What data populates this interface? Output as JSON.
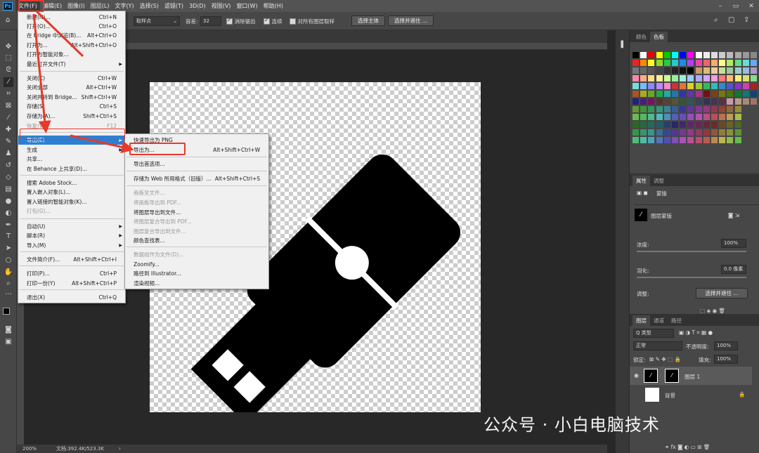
{
  "app": {
    "logo": "Ps"
  },
  "menubar": [
    "文件(F)",
    "编辑(E)",
    "图像(I)",
    "图层(L)",
    "文字(Y)",
    "选择(S)",
    "滤镜(T)",
    "3D(D)",
    "视图(V)",
    "窗口(W)",
    "帮助(H)"
  ],
  "options": {
    "sample_value": "取样点",
    "tolerance_label": "容差:",
    "tolerance_value": "32",
    "antialias": "消除锯齿",
    "contiguous": "连续",
    "sample_all": "对所有图层取样",
    "select_subject": "选择主体",
    "select_mask": "选择并遮住 ..."
  },
  "file_menu": [
    {
      "label": "新建(N)...",
      "shortcut": "Ctrl+N"
    },
    {
      "label": "打开(O)...",
      "shortcut": "Ctrl+O"
    },
    {
      "label": "在 Bridge 中浏览(B)...",
      "shortcut": "Alt+Ctrl+O"
    },
    {
      "label": "打开为...",
      "shortcut": "Alt+Shift+Ctrl+O"
    },
    {
      "label": "打开为智能对象...",
      "shortcut": ""
    },
    {
      "label": "最近打开文件(T)",
      "shortcut": "",
      "sub": true
    },
    {
      "label": "关闭(C)",
      "shortcut": "Ctrl+W"
    },
    {
      "label": "关闭全部",
      "shortcut": "Alt+Ctrl+W"
    },
    {
      "label": "关闭并转到 Bridge...",
      "shortcut": "Shift+Ctrl+W"
    },
    {
      "label": "存储(S)",
      "shortcut": "Ctrl+S"
    },
    {
      "label": "存储为(A)...",
      "shortcut": "Shift+Ctrl+S"
    },
    {
      "label": "恢复(V)",
      "shortcut": "F12",
      "disabled": true
    },
    {
      "label": "导出(E)",
      "shortcut": "",
      "sub": true,
      "highlight": true
    },
    {
      "label": "生成",
      "shortcut": "",
      "sub": true
    },
    {
      "label": "共享...",
      "shortcut": ""
    },
    {
      "label": "在 Behance 上共享(D)...",
      "shortcut": ""
    },
    {
      "label": "搜索 Adobe Stock...",
      "shortcut": ""
    },
    {
      "label": "置入嵌入对象(L)...",
      "shortcut": ""
    },
    {
      "label": "置入链接的智能对象(K)...",
      "shortcut": ""
    },
    {
      "label": "打包(G)...",
      "shortcut": "",
      "disabled": true
    },
    {
      "label": "自动(U)",
      "shortcut": "",
      "sub": true
    },
    {
      "label": "脚本(R)",
      "shortcut": "",
      "sub": true
    },
    {
      "label": "导入(M)",
      "shortcut": "",
      "sub": true
    },
    {
      "label": "文件简介(F)...",
      "shortcut": "Alt+Shift+Ctrl+I"
    },
    {
      "label": "打印(P)...",
      "shortcut": "Ctrl+P"
    },
    {
      "label": "打印一份(Y)",
      "shortcut": "Alt+Shift+Ctrl+P"
    },
    {
      "label": "退出(X)",
      "shortcut": "Ctrl+Q"
    }
  ],
  "export_menu": [
    {
      "label": "快速导出为 PNG",
      "shortcut": ""
    },
    {
      "label": "导出为...",
      "shortcut": "Alt+Shift+Ctrl+W"
    },
    {
      "label": "导出首选项...",
      "shortcut": ""
    },
    {
      "label": "存储为 Web 所用格式（旧版）...",
      "shortcut": "Alt+Shift+Ctrl+S"
    },
    {
      "label": "画板至文件...",
      "shortcut": "",
      "disabled": true
    },
    {
      "label": "将画板导出到 PDF...",
      "shortcut": "",
      "disabled": true
    },
    {
      "label": "将图层导出到文件...",
      "shortcut": ""
    },
    {
      "label": "将图层复合导出到 PDF...",
      "shortcut": "",
      "disabled": true
    },
    {
      "label": "图层复合导出到文件...",
      "shortcut": "",
      "disabled": true
    },
    {
      "label": "颜色查找表...",
      "shortcut": ""
    },
    {
      "label": "数据组作为文件(D)...",
      "shortcut": "",
      "disabled": true
    },
    {
      "label": "Zoomify...",
      "shortcut": ""
    },
    {
      "label": "路径到 Illustrator...",
      "shortcut": ""
    },
    {
      "label": "渲染视频...",
      "shortcut": ""
    }
  ],
  "status": {
    "zoom": "200%",
    "doc": "文档:392.4K/523.3K"
  },
  "panels": {
    "color_tabs": [
      "颜色",
      "色板"
    ],
    "props_tabs": [
      "属性",
      "调整"
    ],
    "props_mask": "蒙版",
    "props_layer_mask": "图层蒙版",
    "density_label": "浓度:",
    "density_value": "100%",
    "feather_label": "羽化:",
    "feather_value": "0.0 像素",
    "adjust_label": "调整:",
    "select_mask_btn": "选择并遮住 ...",
    "layers_tabs": [
      "图层",
      "通道",
      "路径"
    ],
    "kind_label": "Q 类型",
    "blend_mode": "正常",
    "opacity_label": "不透明度:",
    "opacity_value": "100%",
    "lock_label": "锁定:",
    "fill_label": "填充:",
    "fill_value": "100%",
    "layer1": "图层 1",
    "background": "背景"
  },
  "watermark": "公众号 · 小白电脑技术",
  "colors": {
    "accent_red": "#e63a2c",
    "menu_highlight": "#2f7fd0"
  }
}
